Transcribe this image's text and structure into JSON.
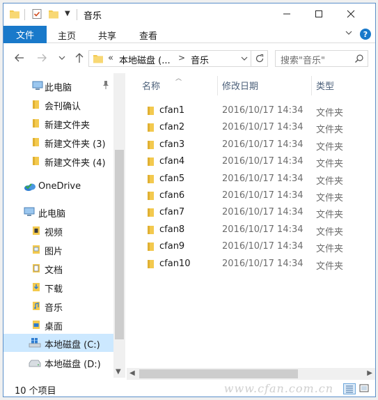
{
  "window": {
    "title": "音乐"
  },
  "ribbon": {
    "file_tab": "文件",
    "tabs": [
      "主页",
      "共享",
      "查看"
    ],
    "help": "?"
  },
  "address": {
    "overflow": "«",
    "crumbs": [
      "本地磁盘 (...",
      "音乐"
    ],
    "separator": ">"
  },
  "search": {
    "placeholder": "搜索\"音乐\""
  },
  "sidebar": {
    "items": [
      {
        "label": "此电脑",
        "icon": "computer-icon"
      },
      {
        "label": "会刊确认",
        "icon": "folder-icon"
      },
      {
        "label": "新建文件夹",
        "icon": "folder-icon"
      },
      {
        "label": "新建文件夹 (3)",
        "icon": "folder-icon"
      },
      {
        "label": "新建文件夹 (4)",
        "icon": "folder-icon"
      },
      {
        "label": "OneDrive",
        "icon": "onedrive-icon"
      },
      {
        "label": "此电脑",
        "icon": "computer-icon"
      },
      {
        "label": "视频",
        "icon": "video-folder-icon"
      },
      {
        "label": "图片",
        "icon": "pictures-folder-icon"
      },
      {
        "label": "文档",
        "icon": "documents-folder-icon"
      },
      {
        "label": "下载",
        "icon": "downloads-folder-icon"
      },
      {
        "label": "音乐",
        "icon": "music-folder-icon"
      },
      {
        "label": "桌面",
        "icon": "desktop-folder-icon"
      },
      {
        "label": "本地磁盘 (C:)",
        "icon": "windows-drive-icon",
        "selected": true
      },
      {
        "label": "本地磁盘 (D:)",
        "icon": "drive-icon"
      }
    ]
  },
  "columns": {
    "name": "名称",
    "date": "修改日期",
    "type": "类型"
  },
  "files": [
    {
      "name": "cfan1",
      "date": "2016/10/17 14:34",
      "type": "文件夹"
    },
    {
      "name": "cfan2",
      "date": "2016/10/17 14:34",
      "type": "文件夹"
    },
    {
      "name": "cfan3",
      "date": "2016/10/17 14:34",
      "type": "文件夹"
    },
    {
      "name": "cfan4",
      "date": "2016/10/17 14:34",
      "type": "文件夹"
    },
    {
      "name": "cfan5",
      "date": "2016/10/17 14:34",
      "type": "文件夹"
    },
    {
      "name": "cfan6",
      "date": "2016/10/17 14:34",
      "type": "文件夹"
    },
    {
      "name": "cfan7",
      "date": "2016/10/17 14:34",
      "type": "文件夹"
    },
    {
      "name": "cfan8",
      "date": "2016/10/17 14:34",
      "type": "文件夹"
    },
    {
      "name": "cfan9",
      "date": "2016/10/17 14:34",
      "type": "文件夹"
    },
    {
      "name": "cfan10",
      "date": "2016/10/17 14:34",
      "type": "文件夹"
    }
  ],
  "status": {
    "item_count": "10 个项目"
  },
  "watermark": "www.cfan.com.cn",
  "colors": {
    "accent": "#1979ca",
    "folder": "#f3c94e",
    "selected": "#cce8ff"
  }
}
